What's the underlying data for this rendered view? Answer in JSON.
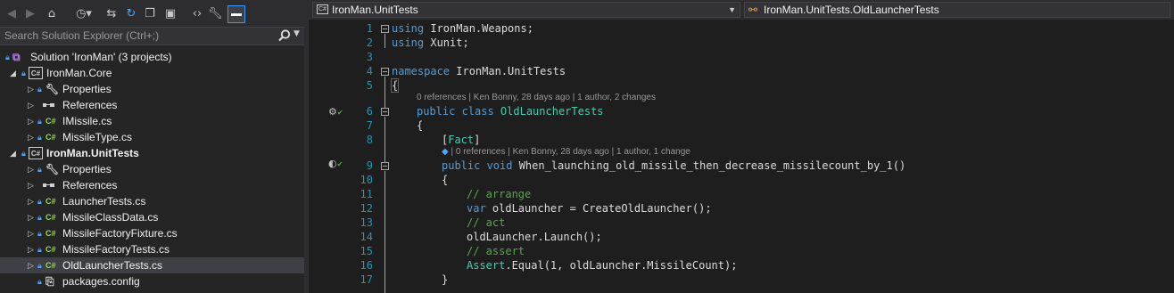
{
  "solution_explorer": {
    "search_placeholder": "Search Solution Explorer (Ctrl+;)",
    "toolbar": {
      "back_icon": "back-icon",
      "forward_icon": "forward-icon",
      "home_icon": "home-icon",
      "history_icon": "history-icon",
      "sync_icon": "sync-icon",
      "refresh_icon": "refresh-icon",
      "collapse_icon": "collapse-all-icon",
      "copy_icon": "show-all-files-icon",
      "code_icon": "view-code-icon",
      "properties_icon": "properties-icon",
      "preview_icon": "preview-selected-icon"
    },
    "tree": {
      "solution": "Solution 'IronMan' (3 projects)",
      "core_project": "IronMan.Core",
      "core_properties": "Properties",
      "core_references": "References",
      "core_imissile": "IMissile.cs",
      "core_missiletype": "MissileType.cs",
      "tests_project": "IronMan.UnitTests",
      "tests_properties": "Properties",
      "tests_references": "References",
      "launchertests": "LauncherTests.cs",
      "missileclassdata": "MissileClassData.cs",
      "missilefactoryfixture": "MissileFactoryFixture.cs",
      "missilefactorytests": "MissileFactoryTests.cs",
      "oldlaunchertests": "OldLauncherTests.cs",
      "packagesconfig": "packages.config"
    }
  },
  "editor": {
    "nav_project": "IronMan.UnitTests",
    "nav_class": "IronMan.UnitTests.OldLauncherTests",
    "lines": {
      "l1_kw": "using",
      "l1_rest": " IronMan.Weapons;",
      "l2_kw": "using",
      "l2_rest": " Xunit;",
      "l4_kw": "namespace",
      "l4_rest": " IronMan.UnitTests",
      "l5": "{",
      "lens1": "0 references | Ken Bonny, 28 days ago | 1 author, 2 changes",
      "l6_kw": "public class",
      "l6_type": " OldLauncherTests",
      "l7": "{",
      "l8_open": "[",
      "l8_attr": "Fact",
      "l8_close": "]",
      "lens2": "| 0 references | Ken Bonny, 28 days ago | 1 author, 1 change",
      "l9_kw": "public void",
      "l9_rest": " When_launching_old_missile_then_decrease_missilecount_by_1()",
      "l10": "{",
      "l11": "// arrange",
      "l12_kw": "var",
      "l12_rest": " oldLauncher = CreateOldLauncher();",
      "l13": "// act",
      "l14": "oldLauncher.Launch();",
      "l15": "// assert",
      "l16_type": "Assert",
      "l16_rest": ".Equal(1, oldLauncher.MissileCount);",
      "l17": "}"
    },
    "line_numbers": [
      "1",
      "2",
      "3",
      "4",
      "5",
      "6",
      "7",
      "8",
      "9",
      "10",
      "11",
      "12",
      "13",
      "14",
      "15",
      "16",
      "17"
    ]
  },
  "colors": {
    "keyword": "#569cd6",
    "type": "#4ec9b0",
    "comment": "#57a64a",
    "line_number": "#2b91af",
    "selection": "#3f3f46"
  }
}
